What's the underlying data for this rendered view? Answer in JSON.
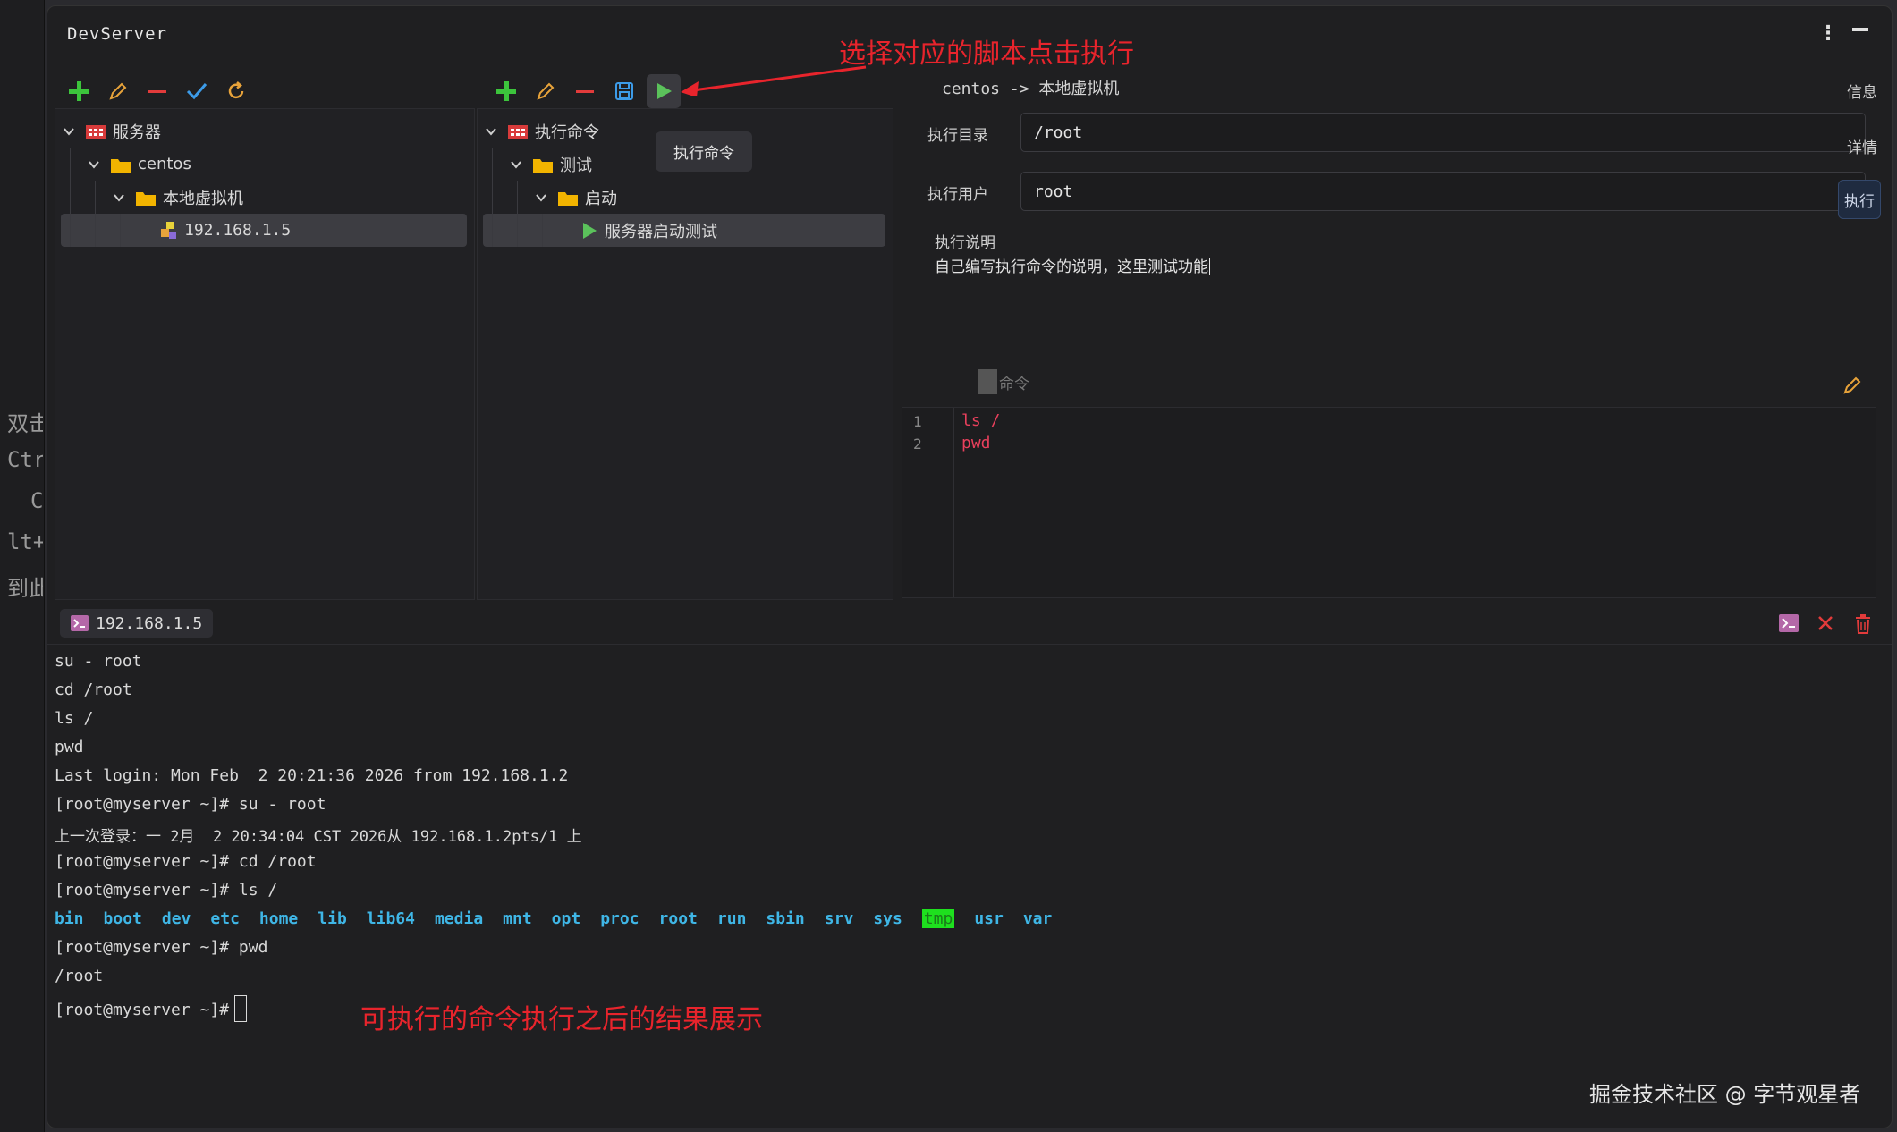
{
  "background_fragments": [
    "双击",
    "Ctrl",
    "C",
    "lt+",
    "到此"
  ],
  "app_title": "DevServer",
  "annotations": {
    "top": "选择对应的脚本点击执行",
    "bottom": "可执行的命令执行之后的结果展示"
  },
  "server_tree": [
    {
      "label": "服务器",
      "icon": "server-group-icon"
    },
    {
      "label": "centos",
      "icon": "folder-icon"
    },
    {
      "label": "本地虚拟机",
      "icon": "folder-icon"
    },
    {
      "label": "192.168.1.5",
      "icon": "host-icon"
    }
  ],
  "command_tree": [
    {
      "label": "执行命令",
      "icon": "command-group-icon"
    },
    {
      "label": "测试",
      "icon": "folder-icon"
    },
    {
      "label": "启动",
      "icon": "folder-icon"
    },
    {
      "label": "服务器启动测试",
      "icon": "play-icon"
    }
  ],
  "tooltip": "执行命令",
  "detail": {
    "path": "centos -> 本地虚拟机",
    "dir_label": "执行目录",
    "dir_value": "/root",
    "user_label": "执行用户",
    "user_value": "root",
    "desc_label": "执行说明",
    "desc_text": "自己编写执行命令的说明，这里测试功能",
    "cmd_label": "命令",
    "side_tabs": {
      "info": "信息",
      "details": "详情",
      "run": "执行"
    }
  },
  "code_lines": [
    {
      "num": "1",
      "text": "ls /"
    },
    {
      "num": "2",
      "text": "pwd"
    }
  ],
  "terminal": {
    "tab_label": "192.168.1.5",
    "lines": [
      "su - root",
      "cd /root",
      "ls /",
      "pwd",
      "Last login: Mon Feb  2 20:21:36 2026 from 192.168.1.2",
      "[root@myserver ~]# su - root",
      "上一次登录：一 2月  2 20:34:04 CST 2026从 192.168.1.2pts/1 上",
      "[root@myserver ~]# cd /root",
      "[root@myserver ~]# ls /"
    ],
    "ls_output": [
      "bin",
      "boot",
      "dev",
      "etc",
      "home",
      "lib",
      "lib64",
      "media",
      "mnt",
      "opt",
      "proc",
      "root",
      "run",
      "sbin",
      "srv",
      "sys",
      "tmp",
      "usr",
      "var"
    ],
    "after_lines": [
      "[root@myserver ~]# pwd",
      "/root"
    ],
    "prompt": "[root@myserver ~]#"
  },
  "watermark": "掘金技术社区 @ 字节观星者",
  "colors": {
    "add": "#3cc43c",
    "edit": "#e8a33a",
    "remove": "#e23b3b",
    "check": "#3c9be8",
    "refresh": "#e8a33a",
    "save": "#3c9be8",
    "run": "#5bc25b",
    "annotation": "#e8242c"
  }
}
